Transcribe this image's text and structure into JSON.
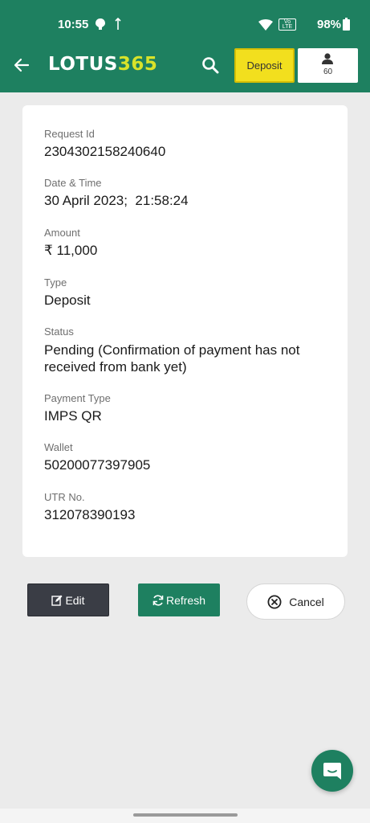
{
  "status_bar": {
    "time": "10:55",
    "battery": "98%",
    "network": "Vo LTE"
  },
  "app_bar": {
    "logo_main": "LOTUS",
    "logo_accent": "365",
    "deposit_label": "Deposit",
    "balance": "60"
  },
  "details": {
    "request_id": {
      "label": "Request Id",
      "value": "2304302158240640"
    },
    "date_time": {
      "label": "Date & Time",
      "value": "30 April 2023;  21:58:24"
    },
    "amount": {
      "label": "Amount",
      "value": "₹ 11,000"
    },
    "type": {
      "label": "Type",
      "value": "Deposit"
    },
    "status": {
      "label": "Status",
      "value": "Pending (Confirmation of payment has not received from bank yet)"
    },
    "payment_type": {
      "label": "Payment Type",
      "value": "IMPS QR"
    },
    "wallet": {
      "label": "Wallet",
      "value": "50200077397905"
    },
    "utr": {
      "label": "UTR No.",
      "value": "312078390193"
    }
  },
  "actions": {
    "edit_label": "Edit",
    "refresh_label": "Refresh",
    "cancel_label": "Cancel"
  },
  "colors": {
    "brand_green": "#1e8060",
    "logo_accent": "#d8e32a",
    "deposit_yellow": "#f2df1e",
    "edit_dark": "#3a3d45"
  },
  "icons": {
    "back": "arrow-left-icon",
    "search": "search-icon",
    "account": "user-icon",
    "edit": "edit-icon",
    "refresh": "refresh-icon",
    "cancel": "close-circle-icon",
    "chat": "chat-icon"
  }
}
